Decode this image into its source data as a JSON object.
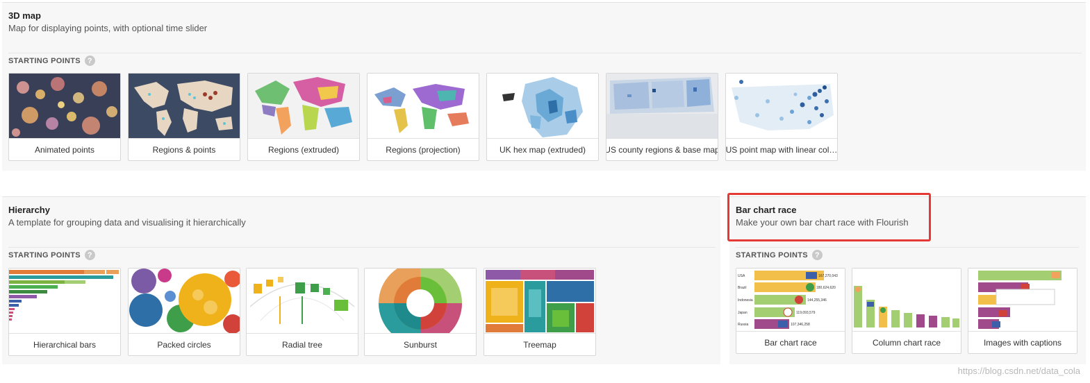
{
  "map3d": {
    "title": "3D map",
    "description": "Map for displaying points, with optional time slider",
    "starting_points_label": "STARTING POINTS",
    "help_symbol": "?",
    "cards": [
      {
        "label": "Animated points"
      },
      {
        "label": "Regions & points"
      },
      {
        "label": "Regions (extruded)"
      },
      {
        "label": "Regions (projection)"
      },
      {
        "label": "UK hex map (extruded)"
      },
      {
        "label": "US county regions & base map"
      },
      {
        "label": "US point map with linear col…"
      }
    ]
  },
  "hierarchy": {
    "title": "Hierarchy",
    "description": "A template for grouping data and visualising it hierarchically",
    "starting_points_label": "STARTING POINTS",
    "help_symbol": "?",
    "cards": [
      {
        "label": "Hierarchical bars"
      },
      {
        "label": "Packed circles"
      },
      {
        "label": "Radial tree"
      },
      {
        "label": "Sunburst"
      },
      {
        "label": "Treemap"
      }
    ]
  },
  "bar_chart_race": {
    "title": "Bar chart race",
    "description": "Make your own bar chart race with Flourish",
    "starting_points_label": "STARTING POINTS",
    "help_symbol": "?",
    "cards": [
      {
        "label": "Bar chart race"
      },
      {
        "label": "Column chart race"
      },
      {
        "label": "Images with captions"
      }
    ],
    "thumb_rows": [
      {
        "country": "USA",
        "value": "167,270,043"
      },
      {
        "country": "Brazil",
        "value": "180,624,620"
      },
      {
        "country": "Indonesia",
        "value": "144,255,346"
      },
      {
        "country": "Japan",
        "value": "119,093,579"
      },
      {
        "country": "Russia",
        "value": "107,346,258"
      }
    ]
  },
  "watermark": "https://blog.csdn.net/data_cola",
  "colors": {
    "highlight": "#e53935",
    "section_bg": "#f7f7f7"
  }
}
